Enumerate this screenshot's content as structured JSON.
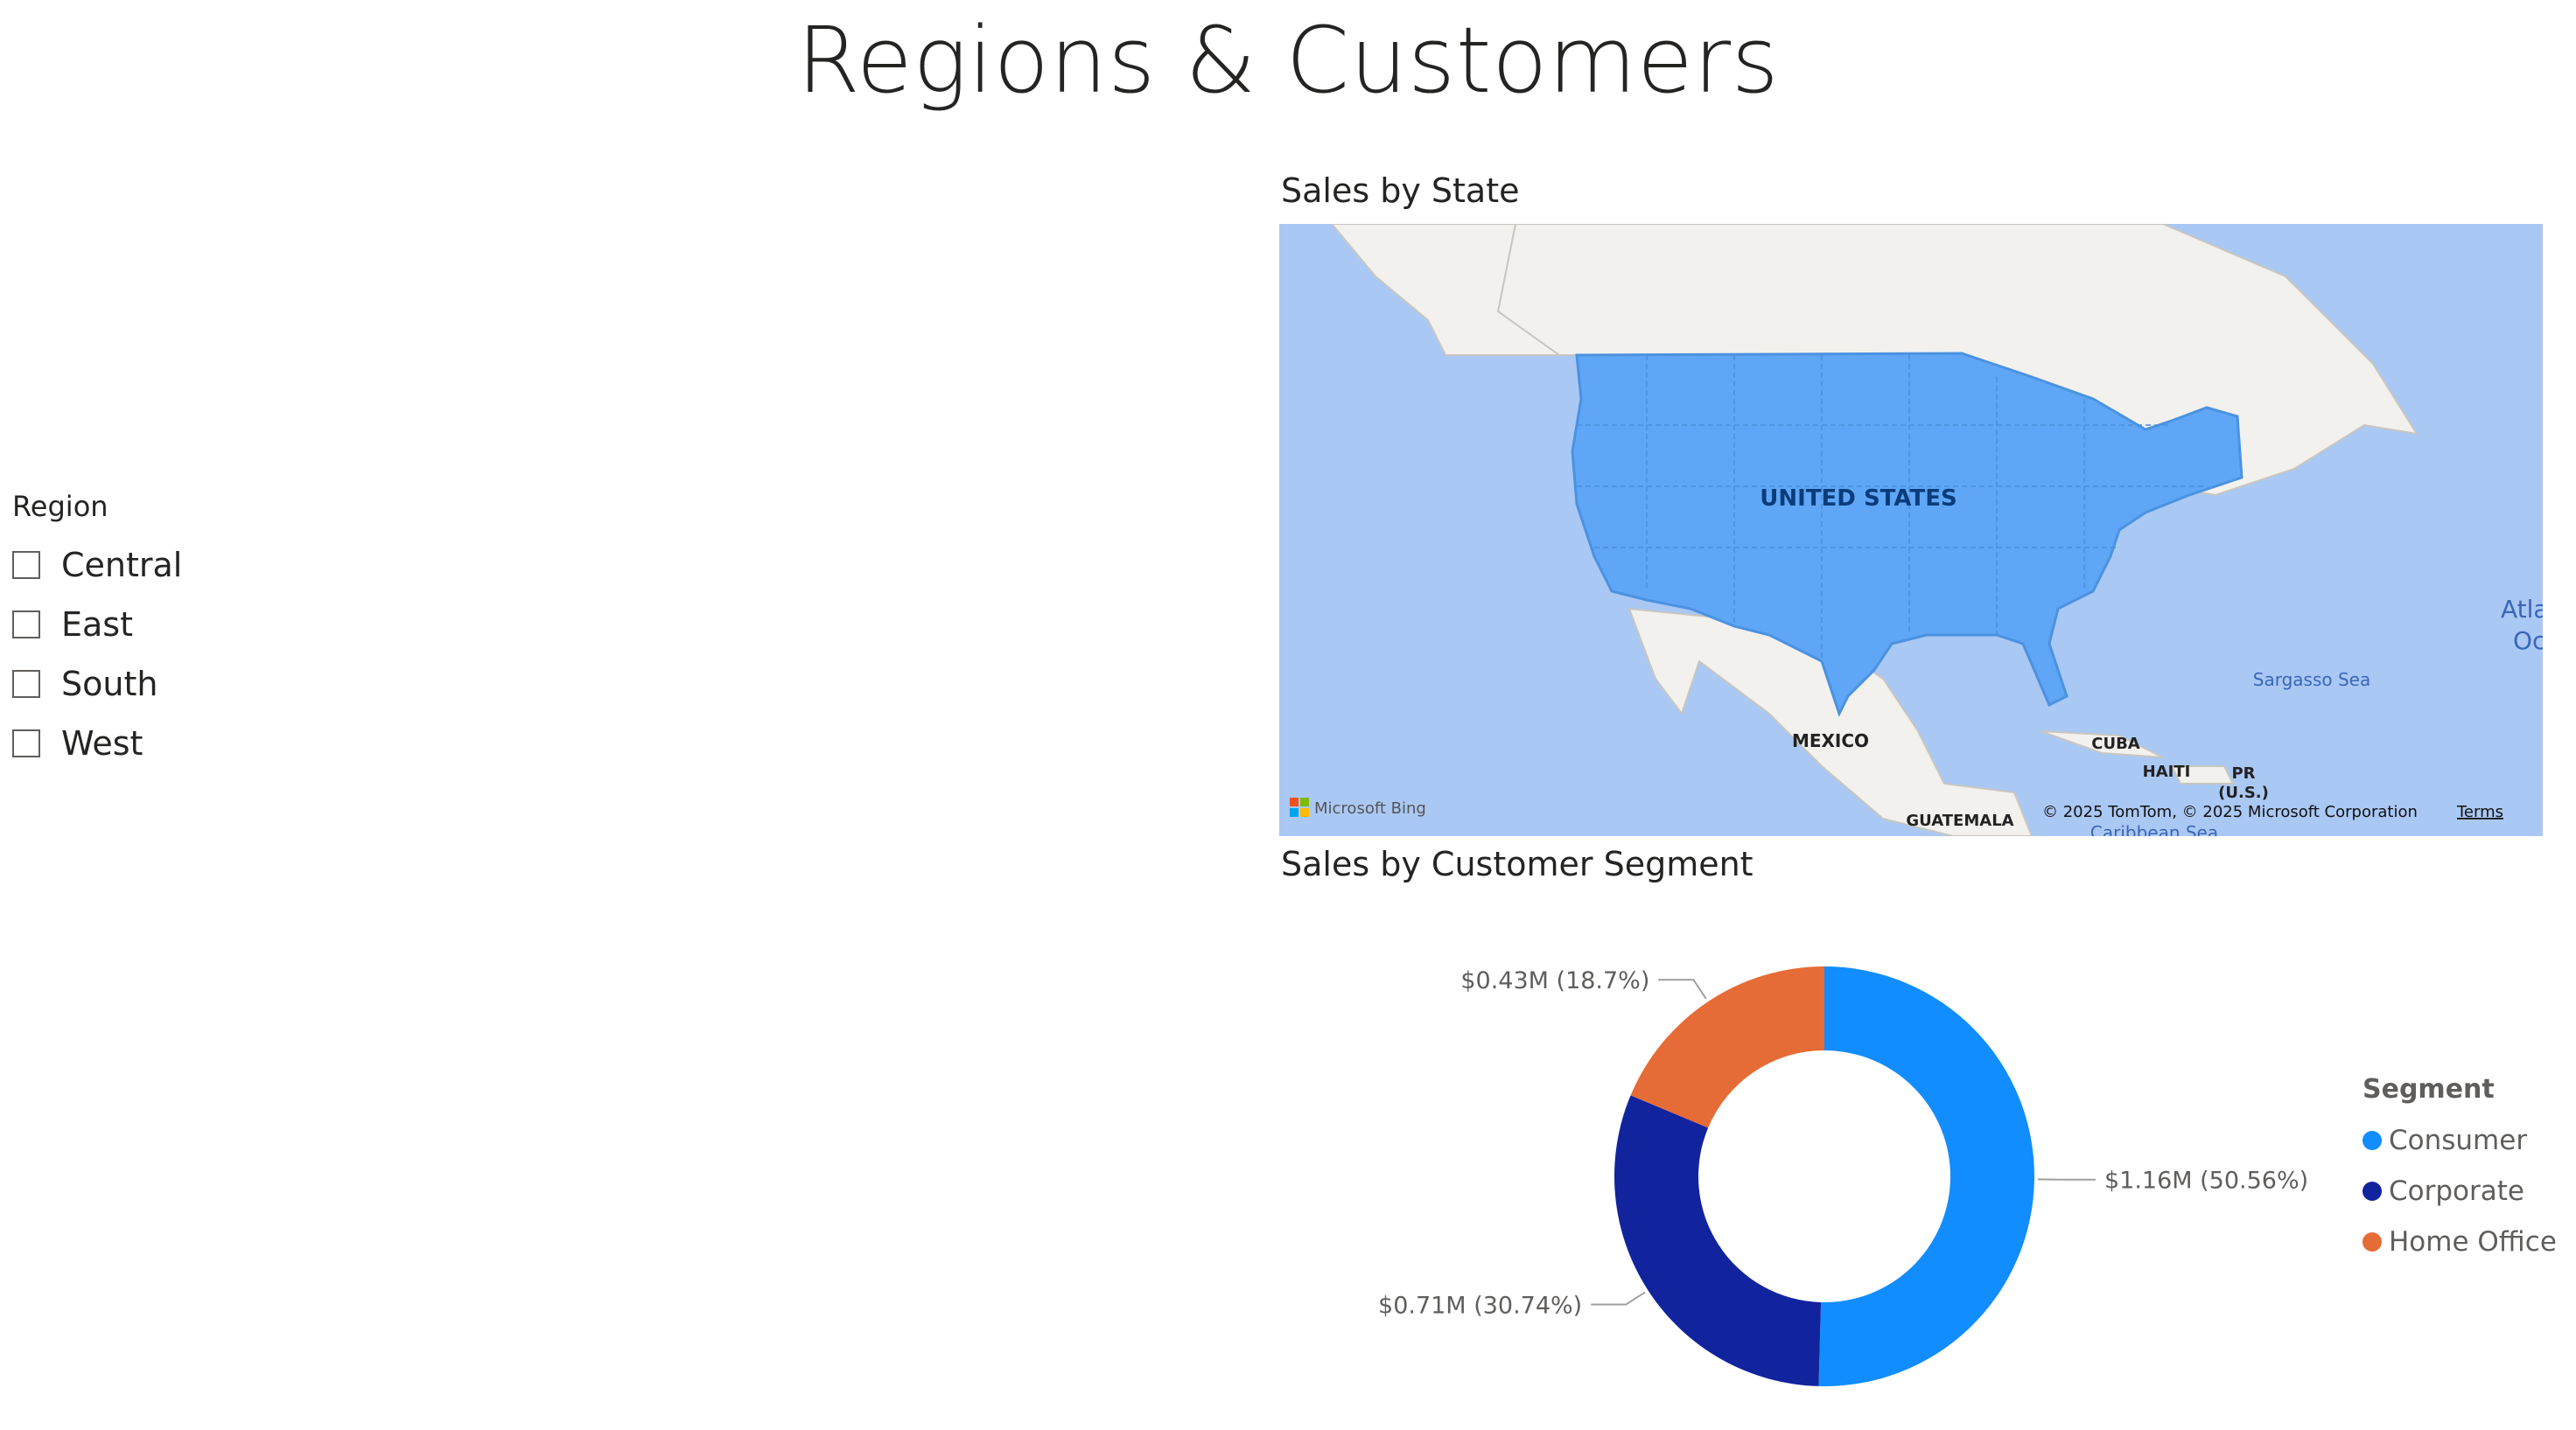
{
  "page": {
    "title": "Regions & Customers"
  },
  "slicer": {
    "title": "Region",
    "items": [
      {
        "label": "Central",
        "checked": false
      },
      {
        "label": "East",
        "checked": false
      },
      {
        "label": "South",
        "checked": false
      },
      {
        "label": "West",
        "checked": false
      }
    ]
  },
  "map": {
    "title": "Sales by State",
    "labels": {
      "country": "UNITED STATES",
      "mexico": "MEXICO",
      "cuba": "CUBA",
      "haiti": "HAITI",
      "pr": "PR",
      "pr_sub": "(U.S.)",
      "guatemala": "GUATEMALA",
      "sargasso": "Sargasso Sea",
      "caribbean": "Caribbean Sea",
      "atlantic1": "Atla",
      "atlantic2": "Oc"
    },
    "attribution": "© 2025 TomTom, © 2025 Microsoft Corporation",
    "terms": "Terms",
    "provider": "Microsoft Bing",
    "colors": {
      "ocean": "#aac8f4",
      "land": "#f2f1ee",
      "highlight": "#5fa7f6",
      "label": "#0b3c7a"
    }
  },
  "segment": {
    "title": "Sales by Customer Segment",
    "legend_title": "Segment"
  },
  "chart_data": {
    "type": "pie",
    "donut": true,
    "categories": [
      "Consumer",
      "Corporate",
      "Home Office"
    ],
    "values": [
      1.16,
      0.71,
      0.43
    ],
    "percentages": [
      50.56,
      30.74,
      18.7
    ],
    "data_labels": [
      "$1.16M (50.56%)",
      "$0.71M (30.74%)",
      "$0.43M (18.7%)"
    ],
    "colors": [
      "#118dff",
      "#12239e",
      "#e66c37"
    ],
    "legend_title": "Segment",
    "legend_position": "right"
  }
}
